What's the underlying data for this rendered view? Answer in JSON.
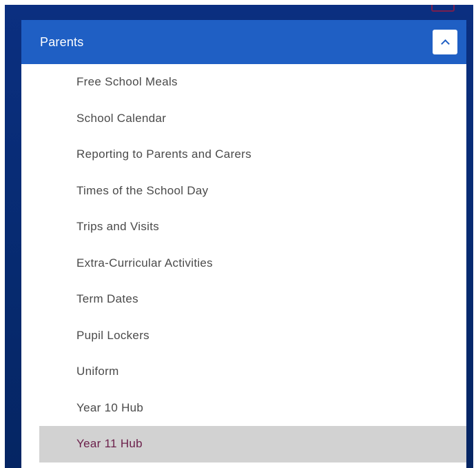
{
  "section": {
    "title": "Parents",
    "toggle_icon": "chevron-up-icon"
  },
  "colors": {
    "frame_background": "#0b2f80",
    "header_background": "#1f5fc4",
    "active_background": "#d2d2d2",
    "active_text": "#6b1f4a",
    "item_text": "#4a4a4a"
  },
  "menu": {
    "items": [
      {
        "label": "Free School Meals",
        "active": false
      },
      {
        "label": "School Calendar",
        "active": false
      },
      {
        "label": "Reporting to Parents and Carers",
        "active": false
      },
      {
        "label": "Times of the School Day",
        "active": false
      },
      {
        "label": "Trips and Visits",
        "active": false
      },
      {
        "label": "Extra-Curricular Activities",
        "active": false
      },
      {
        "label": "Term Dates",
        "active": false
      },
      {
        "label": "Pupil Lockers",
        "active": false
      },
      {
        "label": "Uniform",
        "active": false
      },
      {
        "label": "Year 10 Hub",
        "active": false
      },
      {
        "label": "Year 11 Hub",
        "active": true
      }
    ]
  }
}
